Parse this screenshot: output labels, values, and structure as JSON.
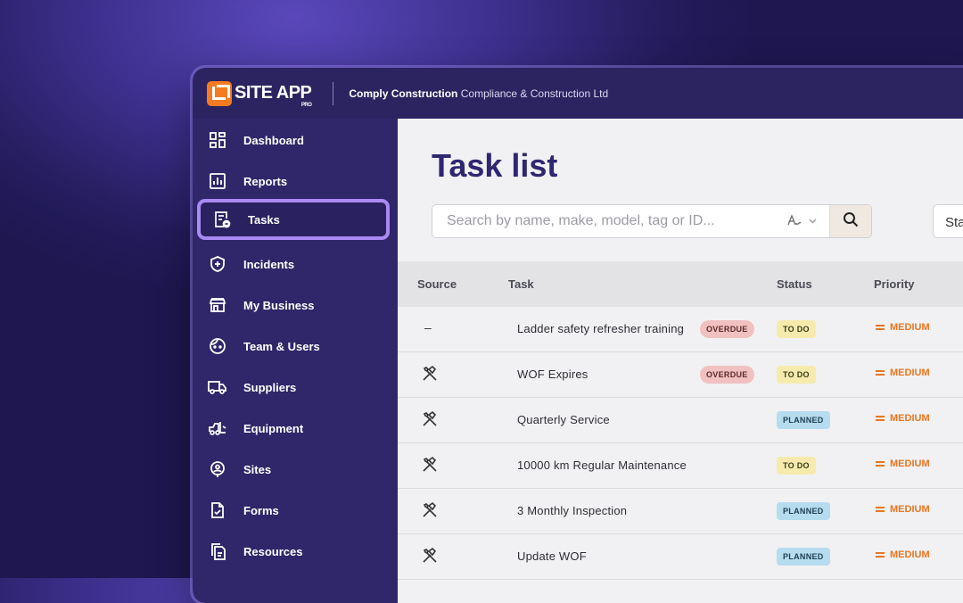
{
  "app": {
    "logo_text": "SITE APP",
    "logo_sub": "PRO",
    "company_name": "Comply Construction",
    "company_legal": "Compliance & Construction Ltd"
  },
  "sidebar": {
    "items": [
      {
        "label": "Dashboard",
        "icon": "dashboard-icon"
      },
      {
        "label": "Reports",
        "icon": "reports-icon"
      },
      {
        "label": "Tasks",
        "icon": "tasks-icon",
        "active": true
      },
      {
        "label": "Incidents",
        "icon": "shield-plus-icon"
      },
      {
        "label": "My Business",
        "icon": "store-icon"
      },
      {
        "label": "Team & Users",
        "icon": "face-icon"
      },
      {
        "label": "Suppliers",
        "icon": "truck-icon"
      },
      {
        "label": "Equipment",
        "icon": "forklift-icon"
      },
      {
        "label": "Sites",
        "icon": "location-icon"
      },
      {
        "label": "Forms",
        "icon": "form-check-icon"
      },
      {
        "label": "Resources",
        "icon": "documents-icon"
      }
    ]
  },
  "main": {
    "title": "Task list",
    "search": {
      "placeholder": "Search by name, make, model, tag or ID...",
      "search_icon": "search-icon"
    },
    "status_filter": "Sta"
  },
  "table": {
    "columns": [
      "Source",
      "Task",
      "Status",
      "Priority"
    ],
    "rows": [
      {
        "source": "–",
        "task": "Ladder safety refresher training",
        "overdue": "OVERDUE",
        "status": "TO DO",
        "priority": "MEDIUM"
      },
      {
        "source": "tools-icon",
        "task": "WOF Expires",
        "overdue": "OVERDUE",
        "status": "TO DO",
        "priority": "MEDIUM"
      },
      {
        "source": "tools-icon",
        "task": "Quarterly Service",
        "overdue": "",
        "status": "PLANNED",
        "priority": "MEDIUM"
      },
      {
        "source": "tools-icon",
        "task": "10000 km Regular Maintenance",
        "overdue": "",
        "status": "TO DO",
        "priority": "MEDIUM"
      },
      {
        "source": "tools-icon",
        "task": "3 Monthly Inspection",
        "overdue": "",
        "status": "PLANNED",
        "priority": "MEDIUM"
      },
      {
        "source": "tools-icon",
        "task": "Update WOF",
        "overdue": "",
        "status": "PLANNED",
        "priority": "MEDIUM"
      }
    ]
  },
  "colors": {
    "accent": "#2f2770",
    "sidebar_bg": "#2f2769",
    "active_outline": "#a98af2",
    "priority_medium": "#e77620",
    "overdue_bg": "#f1c1c1",
    "todo_bg": "#f6ebad",
    "planned_bg": "#b6dcef"
  }
}
